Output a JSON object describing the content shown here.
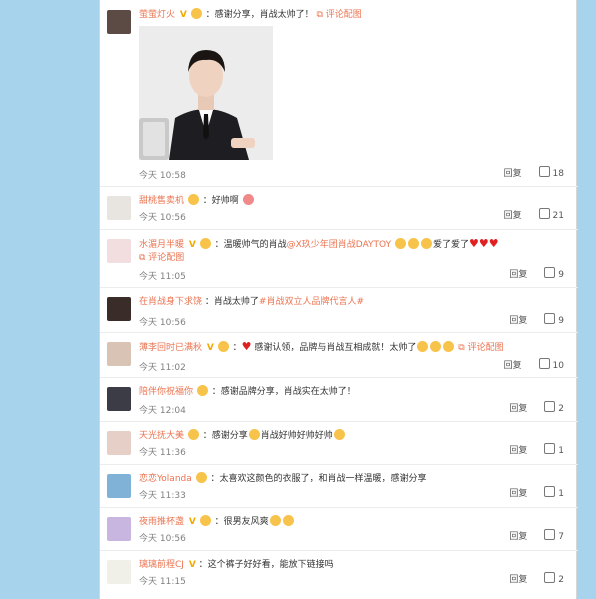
{
  "comments": [
    {
      "user": "萤萤灯火",
      "text": "：感谢分享，肖战太帅了！",
      "img_link": "评论配图",
      "time": "今天 10:58",
      "reply": "回复",
      "likes": "18"
    },
    {
      "user": "甜桃售卖机",
      "text": "：好帅啊",
      "time": "今天 10:56",
      "reply": "回复",
      "likes": "21"
    },
    {
      "user": "水湄月半暖",
      "text": "：温暖帅气的肖战",
      "tag": "@X玖少年团肖战DAYTOY",
      "text2": "爱了爱了",
      "img_link": "评论配图",
      "time": "今天 11:05",
      "reply": "回复",
      "likes": "9"
    },
    {
      "user": "在肖战身下求饶",
      "text": "：肖战太帅了",
      "tag": "#肖战双立人品牌代言人#",
      "time": "今天 10:56",
      "reply": "回复",
      "likes": "9"
    },
    {
      "user": "薄李回时已满秋",
      "text": "：",
      "text2": "感谢认领，品牌与肖战互相成就！太帅了",
      "img_link": "评论配图",
      "time": "今天 11:02",
      "reply": "回复",
      "likes": "10"
    },
    {
      "user": "陪伴你祝福你",
      "text": "：感谢品牌分享，肖战实在太帅了！",
      "time": "今天 12:04",
      "reply": "回复",
      "likes": "2"
    },
    {
      "user": "天光抚大美",
      "text": "：感谢分享",
      "text2": "肖战好帅好帅好帅",
      "time": "今天 11:36",
      "reply": "回复",
      "likes": "1"
    },
    {
      "user": "恋恋Yolanda",
      "text": "：太喜欢这颜色的衣服了，和肖战一样温暖，感谢分享",
      "time": "今天 11:33",
      "reply": "回复",
      "likes": "1"
    },
    {
      "user": "夜雨推杯盏",
      "text": "：很男友风爽",
      "time": "今天 10:56",
      "reply": "回复",
      "likes": "7"
    },
    {
      "user": "璃璃前程CJ",
      "text": "：这个裤子好好看，能放下链接吗",
      "time": "今天 11:15",
      "reply": "回复",
      "likes": "2"
    }
  ],
  "colors": {
    "background": "#a8d3ec",
    "username": "#eb7350",
    "panel": "#ffffff"
  }
}
